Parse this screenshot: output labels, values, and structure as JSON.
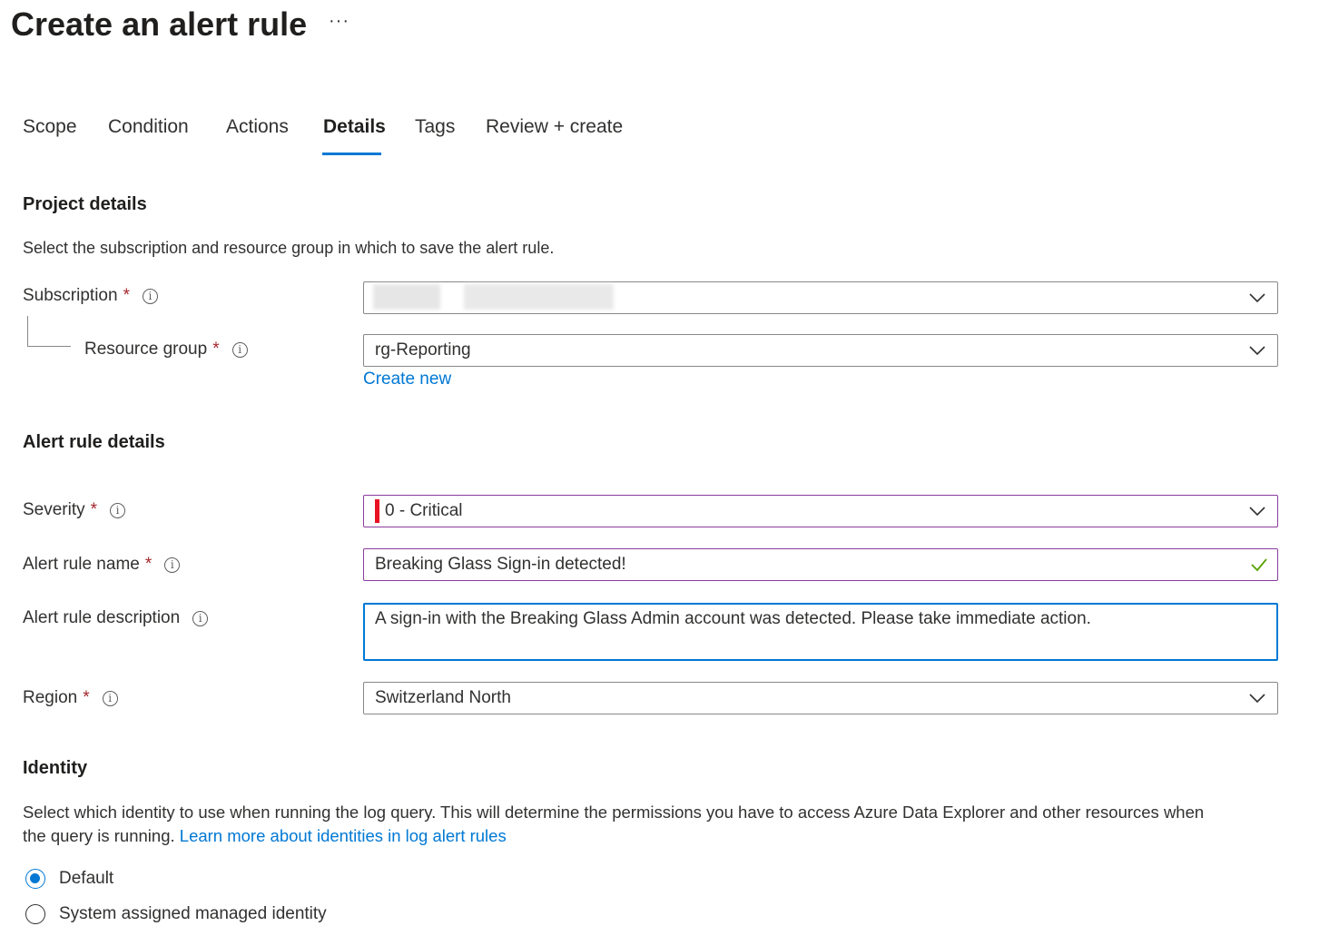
{
  "page": {
    "title": "Create an alert rule",
    "more_label": "···"
  },
  "tabs": [
    {
      "label": "Scope"
    },
    {
      "label": "Condition"
    },
    {
      "label": "Actions"
    },
    {
      "label": "Details",
      "active": true
    },
    {
      "label": "Tags"
    },
    {
      "label": "Review + create"
    }
  ],
  "project_details": {
    "heading": "Project details",
    "description": "Select the subscription and resource group in which to save the alert rule.",
    "subscription": {
      "label": "Subscription",
      "required_mark": "*",
      "value": ""
    },
    "resource_group": {
      "label": "Resource group",
      "required_mark": "*",
      "value": "rg-Reporting"
    },
    "create_new_link": "Create new"
  },
  "alert_rule_details": {
    "heading": "Alert rule details",
    "severity": {
      "label": "Severity",
      "required_mark": "*",
      "value": "0 - Critical",
      "indicator_color": "#e81123"
    },
    "name": {
      "label": "Alert rule name",
      "required_mark": "*",
      "value": "Breaking Glass Sign-in detected!",
      "valid": true
    },
    "description": {
      "label": "Alert rule description",
      "value": "A sign-in with the Breaking Glass Admin account was detected. Please take immediate action."
    },
    "region": {
      "label": "Region",
      "required_mark": "*",
      "value": "Switzerland North"
    }
  },
  "identity": {
    "heading": "Identity",
    "description_line1": "Select which identity to use when running the log query. This will determine the permissions you have to access Azure Data Explorer and other resources when",
    "description_line2": "the query is running.",
    "learn_more_link": "Learn more about identities in log alert rules",
    "options": [
      {
        "label": "Default",
        "selected": true
      },
      {
        "label": "System assigned managed identity",
        "selected": false
      }
    ]
  },
  "colors": {
    "accent": "#0078d4",
    "required": "#a4262c",
    "focus_border": "#8b3c9e",
    "valid_check": "#57a300"
  },
  "icons": [
    "info-icon",
    "chevron-down-icon",
    "checkmark-icon",
    "more-icon"
  ]
}
